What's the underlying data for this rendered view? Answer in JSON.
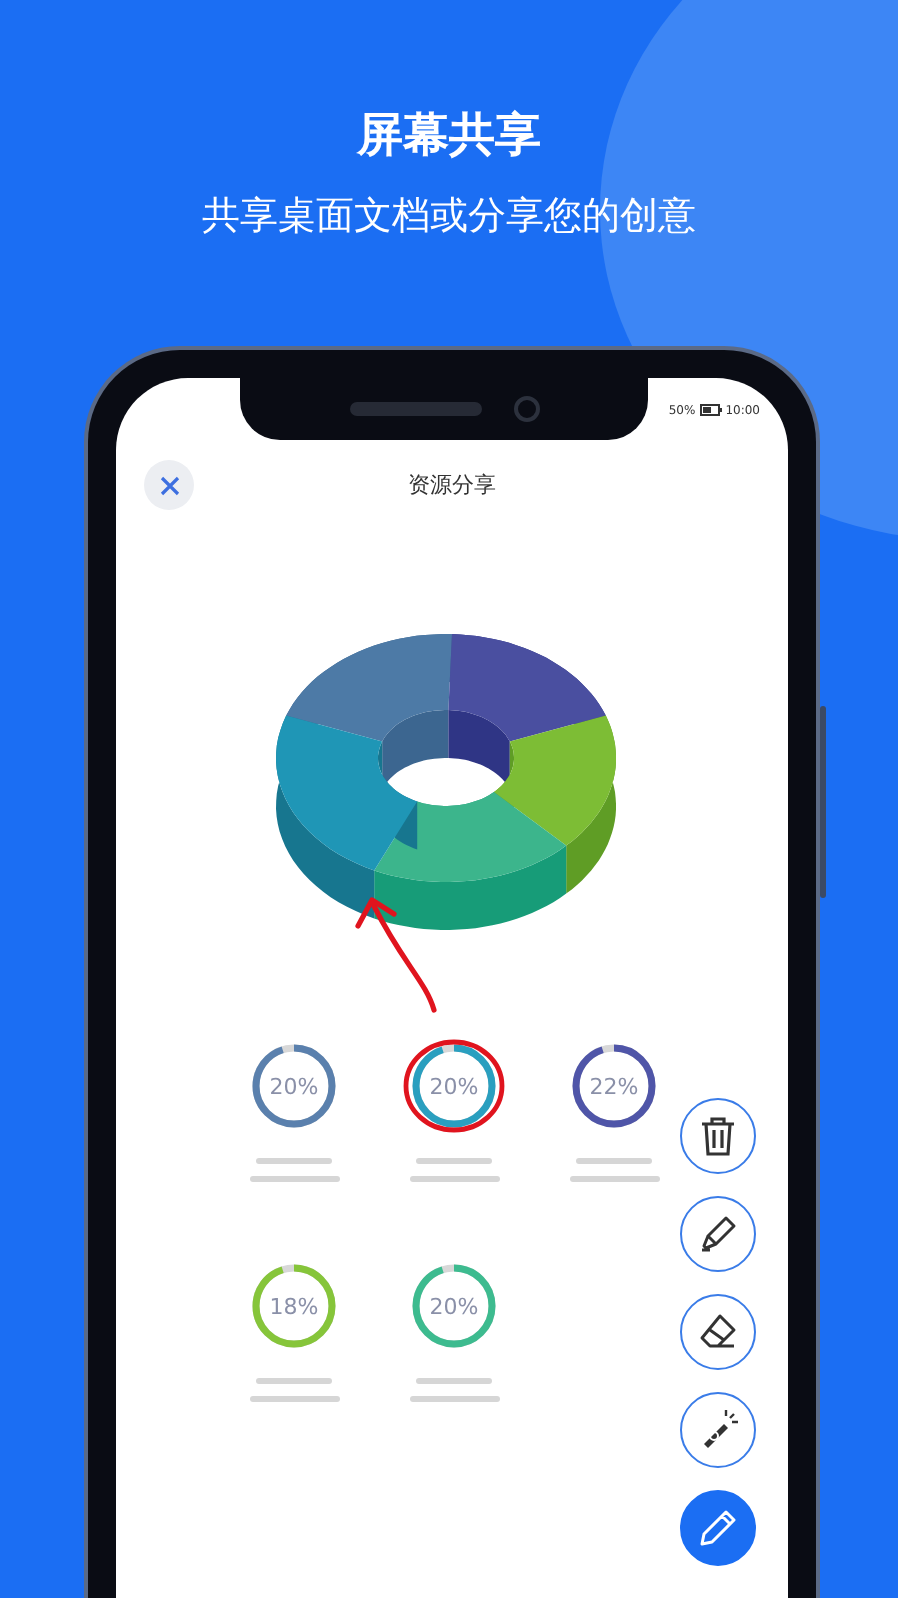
{
  "headline": {
    "title": "屏幕共享",
    "subtitle": "共享桌面文档或分享您的创意"
  },
  "status_bar": {
    "battery": "50%",
    "time": "10:00"
  },
  "screen": {
    "title": "资源分享"
  },
  "gauges": [
    {
      "reading": "20%",
      "level": 0.95,
      "color": "#5a80ad",
      "annotated": false
    },
    {
      "reading": "20%",
      "level": 0.95,
      "color": "#2a9fbf",
      "annotated": true
    },
    {
      "reading": "22%",
      "level": 0.95,
      "color": "#4f55a8",
      "annotated": false
    },
    {
      "reading": "18%",
      "level": 0.95,
      "color": "#86c53a",
      "annotated": false
    },
    {
      "reading": "20%",
      "level": 0.95,
      "color": "#3dbb8f",
      "annotated": false
    }
  ],
  "tools": [
    {
      "kind": "trash",
      "selected": false
    },
    {
      "kind": "highlighter",
      "selected": false
    },
    {
      "kind": "eraser",
      "selected": false
    },
    {
      "kind": "laser",
      "selected": false
    },
    {
      "kind": "pen",
      "selected": true
    }
  ]
}
